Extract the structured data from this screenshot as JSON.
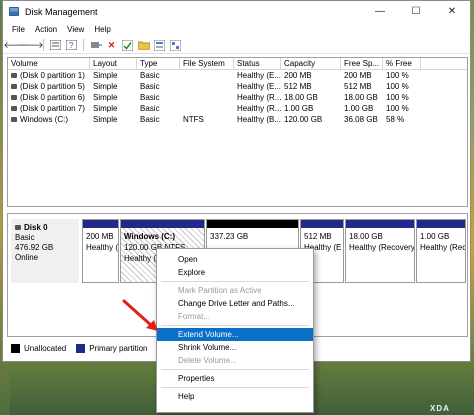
{
  "window": {
    "title": "Disk Management",
    "minimize": "—",
    "maximize": "☐",
    "close": "✕"
  },
  "menu": [
    "File",
    "Action",
    "View",
    "Help"
  ],
  "toolbar_icons": [
    "back-icon",
    "forward-icon",
    "list-icon",
    "help-icon",
    "connect-icon",
    "delete-icon",
    "check-icon",
    "folder-icon",
    "properties-icon",
    "view-icon"
  ],
  "volume_table": {
    "headers": [
      "Volume",
      "Layout",
      "Type",
      "File System",
      "Status",
      "Capacity",
      "Free Sp...",
      "% Free"
    ],
    "rows": [
      [
        "(Disk 0 partition 1)",
        "Simple",
        "Basic",
        "",
        "Healthy (E...",
        "200 MB",
        "200 MB",
        "100 %"
      ],
      [
        "(Disk 0 partition 5)",
        "Simple",
        "Basic",
        "",
        "Healthy (E...",
        "512 MB",
        "512 MB",
        "100 %"
      ],
      [
        "(Disk 0 partition 6)",
        "Simple",
        "Basic",
        "",
        "Healthy (R...",
        "18.00 GB",
        "18.00 GB",
        "100 %"
      ],
      [
        "(Disk 0 partition 7)",
        "Simple",
        "Basic",
        "",
        "Healthy (R...",
        "1.00 GB",
        "1.00 GB",
        "100 %"
      ],
      [
        "Windows (C:)",
        "Simple",
        "Basic",
        "NTFS",
        "Healthy (B...",
        "120.00 GB",
        "36.08 GB",
        "58 %"
      ]
    ]
  },
  "disk": {
    "name": "Disk 0",
    "type": "Basic",
    "size": "476.92 GB",
    "status": "Online",
    "partitions": [
      {
        "line1": "200 MB",
        "line2": "Healthy (",
        "kind": "primary"
      },
      {
        "title": "Windows (C:)",
        "line1": "120.00 GB NTFS",
        "line2": "Healthy (B",
        "kind": "primary"
      },
      {
        "line1": "337.23 GB",
        "line2": "",
        "kind": "unallocated"
      },
      {
        "line1": "512 MB",
        "line2": "Healthy (E",
        "kind": "primary"
      },
      {
        "line1": "18.00 GB",
        "line2": "Healthy (Recovery",
        "kind": "primary"
      },
      {
        "line1": "1.00 GB",
        "line2": "Healthy (Recove",
        "kind": "primary"
      }
    ]
  },
  "legend": {
    "unallocated": "Unallocated",
    "primary": "Primary partition"
  },
  "context_menu": {
    "open": "Open",
    "explore": "Explore",
    "mark_active": "Mark Partition as Active",
    "change_letter": "Change Drive Letter and Paths...",
    "format": "Format...",
    "extend": "Extend Volume...",
    "shrink": "Shrink Volume...",
    "delete": "Delete Volume...",
    "properties": "Properties",
    "help": "Help"
  },
  "watermark": "XDA",
  "colors": {
    "primary_partition": "#1f2a8a",
    "unallocated": "#000000",
    "highlight": "#0a6fc9",
    "arrow": "#e0201b"
  }
}
